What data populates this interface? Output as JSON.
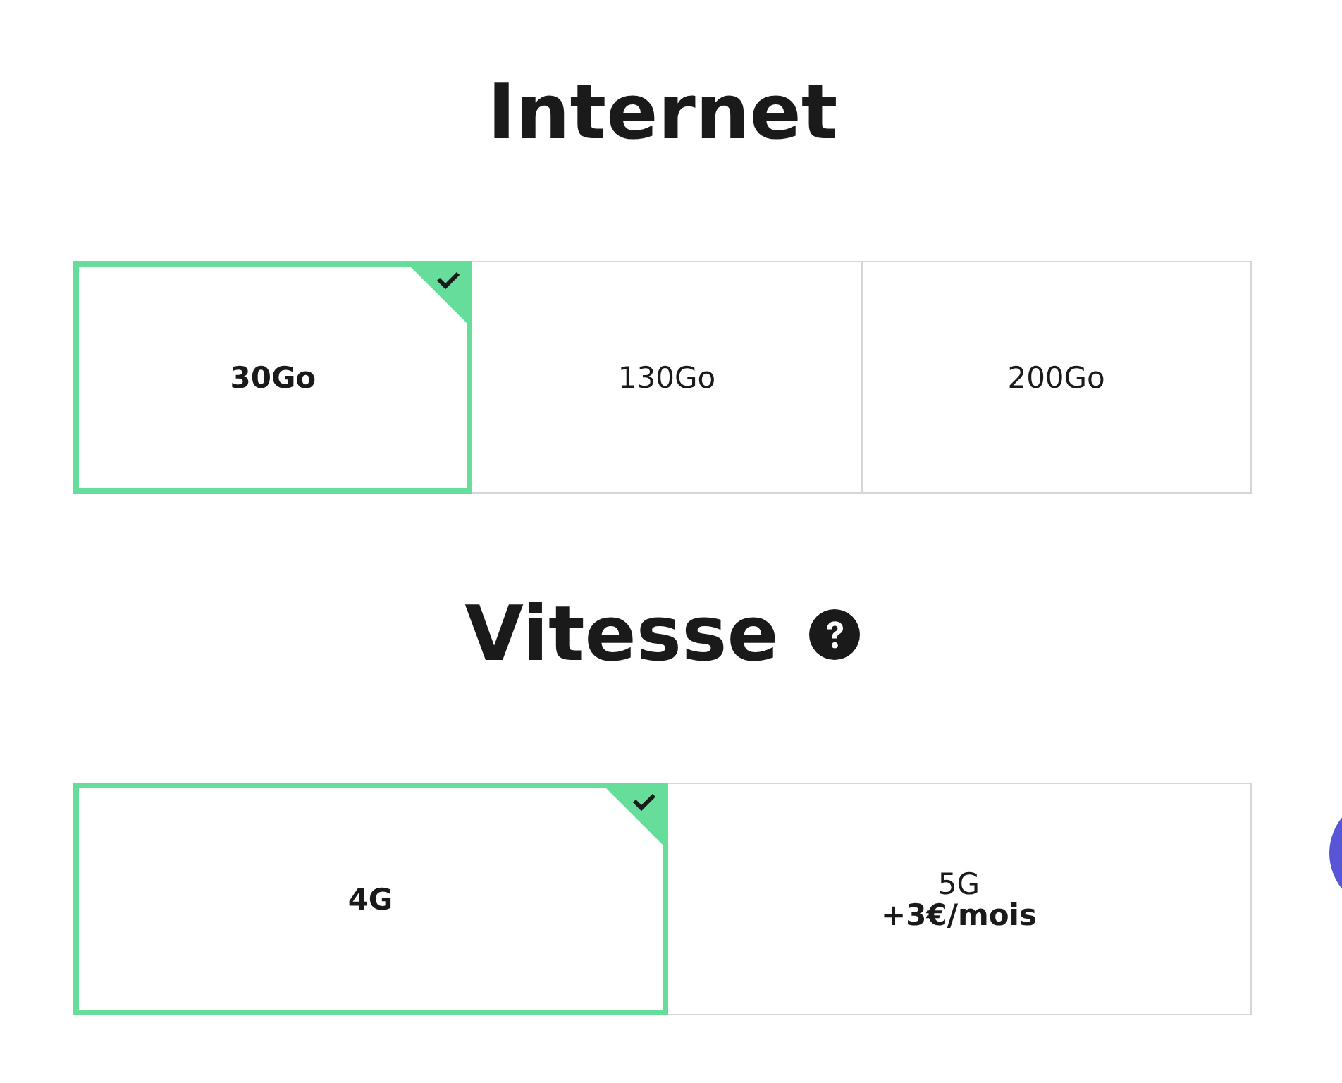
{
  "sections": [
    {
      "title": "Internet",
      "help": false,
      "options": [
        {
          "label": "30Go",
          "selected": true
        },
        {
          "label": "130Go",
          "selected": false
        },
        {
          "label": "200Go",
          "selected": false
        }
      ]
    },
    {
      "title": "Vitesse",
      "help": true,
      "options": [
        {
          "label": "4G",
          "selected": true
        },
        {
          "label": "5G",
          "note": "+3€/mois",
          "selected": false
        }
      ]
    }
  ],
  "chat_button": true
}
